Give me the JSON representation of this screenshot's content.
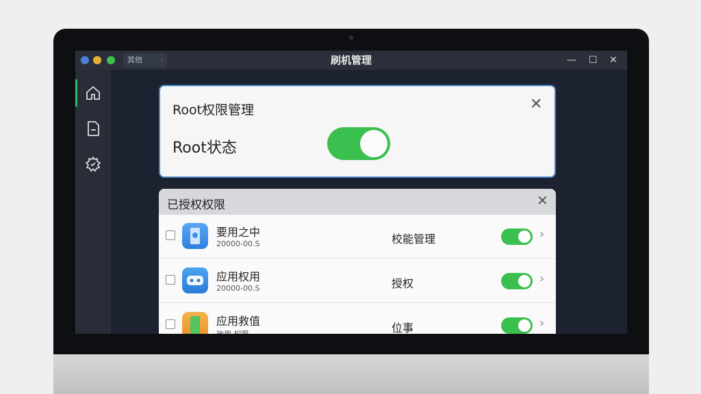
{
  "window": {
    "title": "刷机管理",
    "mini_tab": "其他",
    "mini_tab_chevron": "›",
    "controls": {
      "minimize": "—",
      "maximize": "☐",
      "close": "✕"
    }
  },
  "sidebar": {
    "items": [
      {
        "icon": "home-icon",
        "active": true
      },
      {
        "icon": "document-icon",
        "active": false
      },
      {
        "icon": "gear-icon",
        "active": false
      }
    ]
  },
  "root_card": {
    "title": "Root权限管理",
    "close": "✕",
    "status_label": "Root状态",
    "status_on": true
  },
  "authorized_card": {
    "title": "已授权权限",
    "close": "✕",
    "rows": [
      {
        "name": "要用之中",
        "sub": "20000-00.S",
        "permission": "校能管理",
        "enabled": true,
        "chevron": "›"
      },
      {
        "name": "应用权用",
        "sub": "20000-00.S",
        "permission": "授权",
        "enabled": true,
        "chevron": "›"
      },
      {
        "name": "应用救值",
        "sub": "放用 权限",
        "permission": "位事",
        "enabled": true,
        "chevron": "›"
      }
    ]
  },
  "colors": {
    "accent_green": "#3bbf4f",
    "card_border": "#4b86c6",
    "app_icon_1": "#3f8fe8",
    "app_icon_2": "#2f86e0",
    "app_icon_3": "#f0a23a"
  }
}
